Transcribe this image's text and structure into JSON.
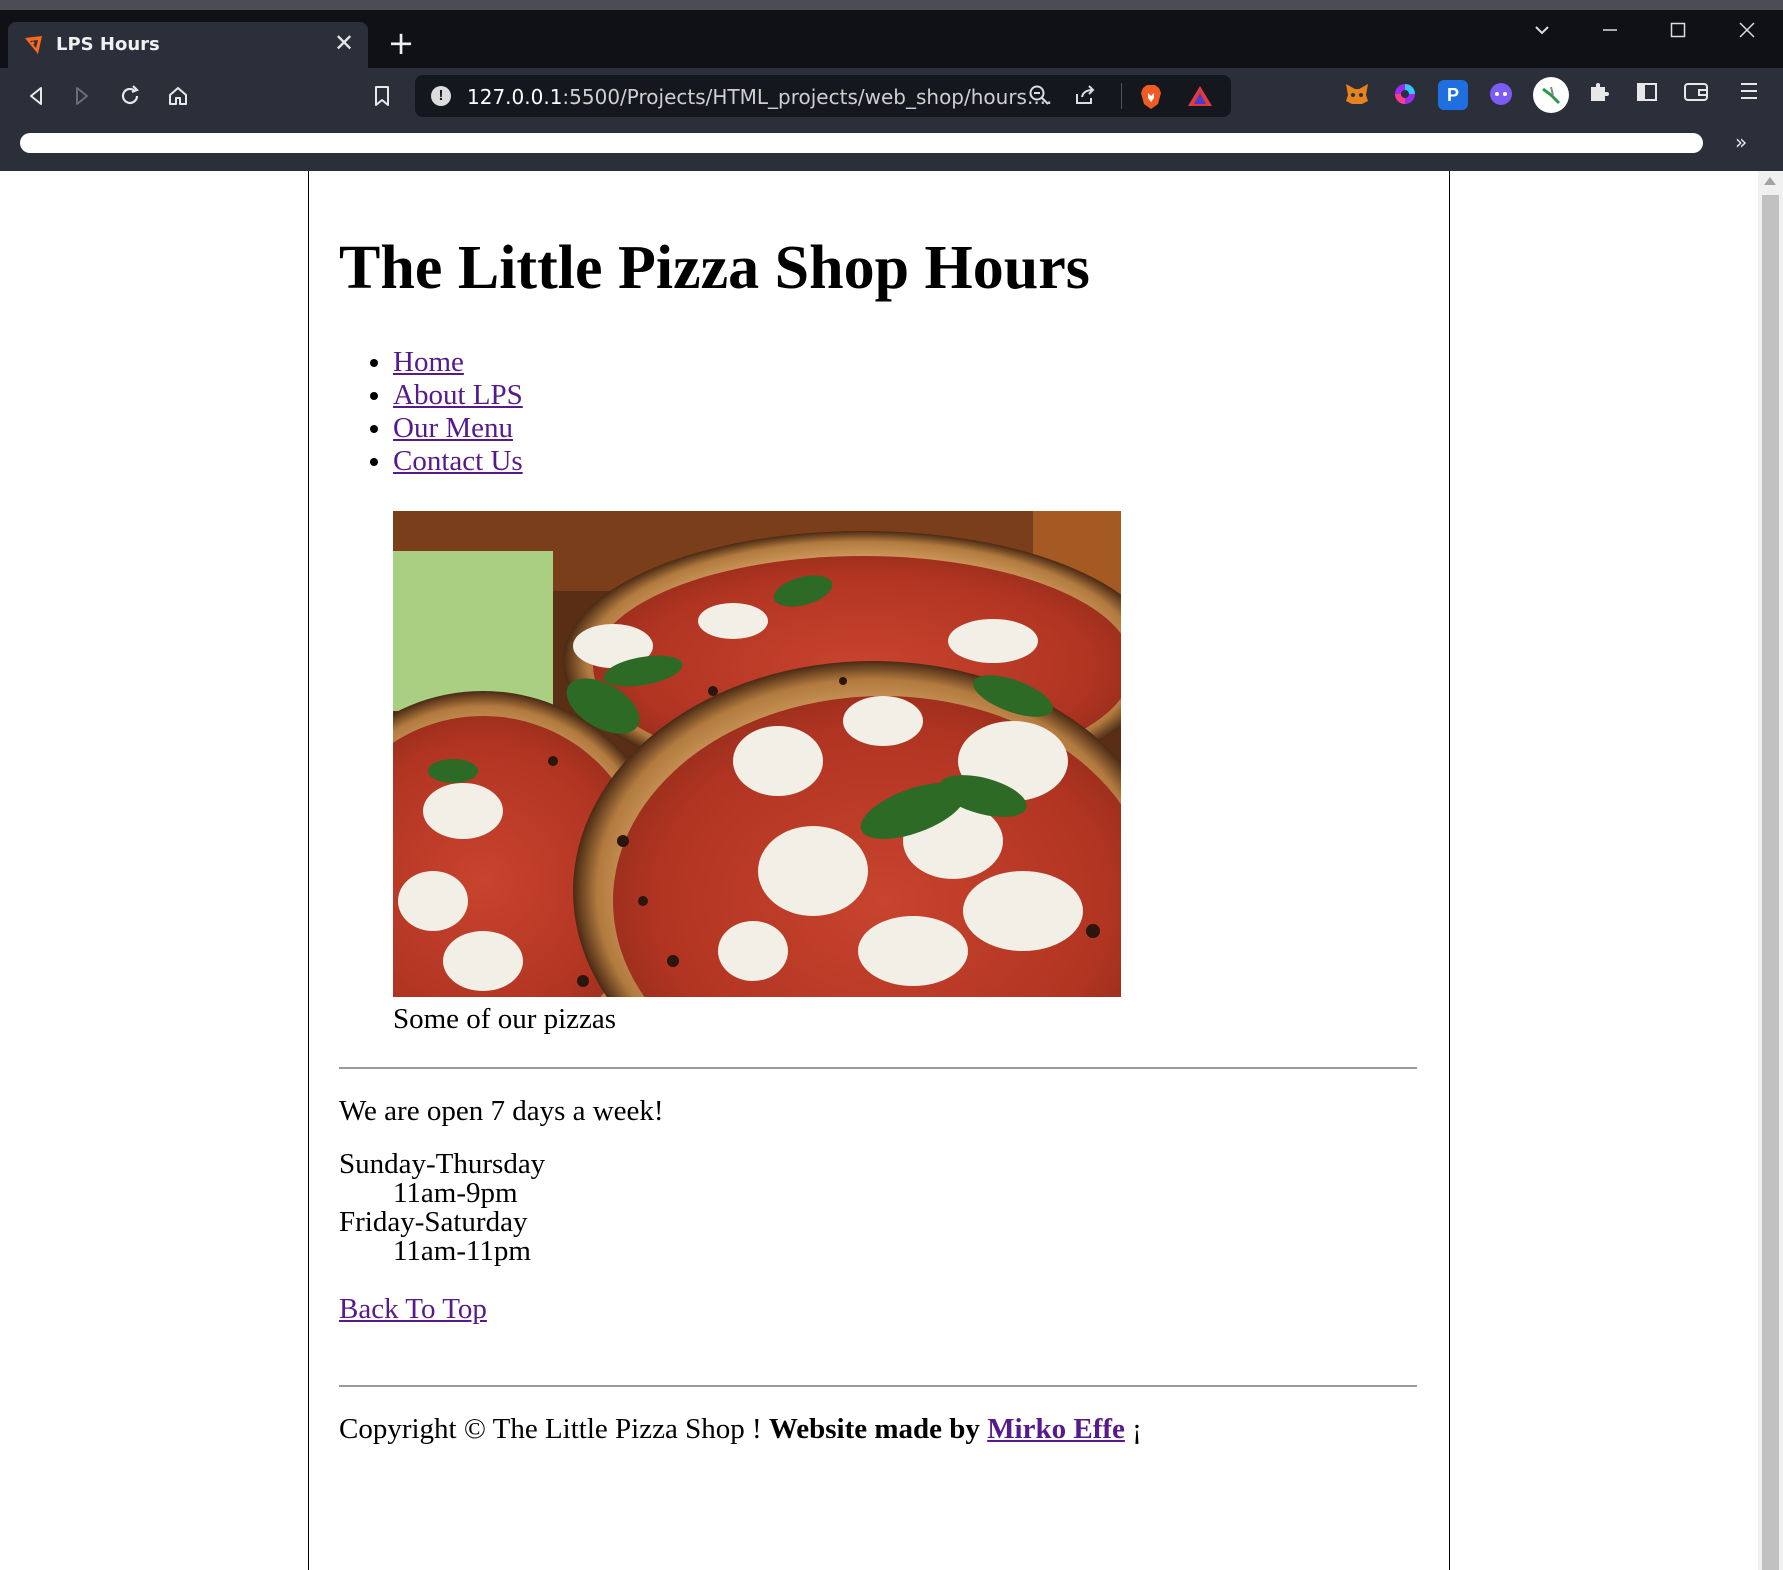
{
  "browser": {
    "tab_title": "LPS Hours",
    "tab_close": "✕",
    "new_tab": "+",
    "url_host": "127.0.0.1",
    "url_rest": ":5500/Projects/HTML_projects/web_shop/hours....",
    "bookmarks_overflow": "»"
  },
  "page": {
    "heading": "The Little Pizza Shop Hours",
    "nav": [
      {
        "label": "Home"
      },
      {
        "label": "About LPS"
      },
      {
        "label": "Our Menu"
      },
      {
        "label": "Contact Us"
      }
    ],
    "figure_caption": "Some of our pizzas",
    "open_text": "We are open 7 days a week!",
    "hours": [
      {
        "days": "Sunday-Thursday",
        "time": "11am-9pm"
      },
      {
        "days": "Friday-Saturday",
        "time": "11am-11pm"
      }
    ],
    "back_to_top": "Back To Top",
    "footer": {
      "copyright": "Copyright © The Little Pizza Shop ! ",
      "made_by": "Website made by",
      "author": "Mirko Effe",
      "suffix": " ¡"
    }
  },
  "colors": {
    "link": "#551a8b",
    "chrome_bg": "#2b2f3a",
    "titlebar_bg": "#0f1117"
  }
}
